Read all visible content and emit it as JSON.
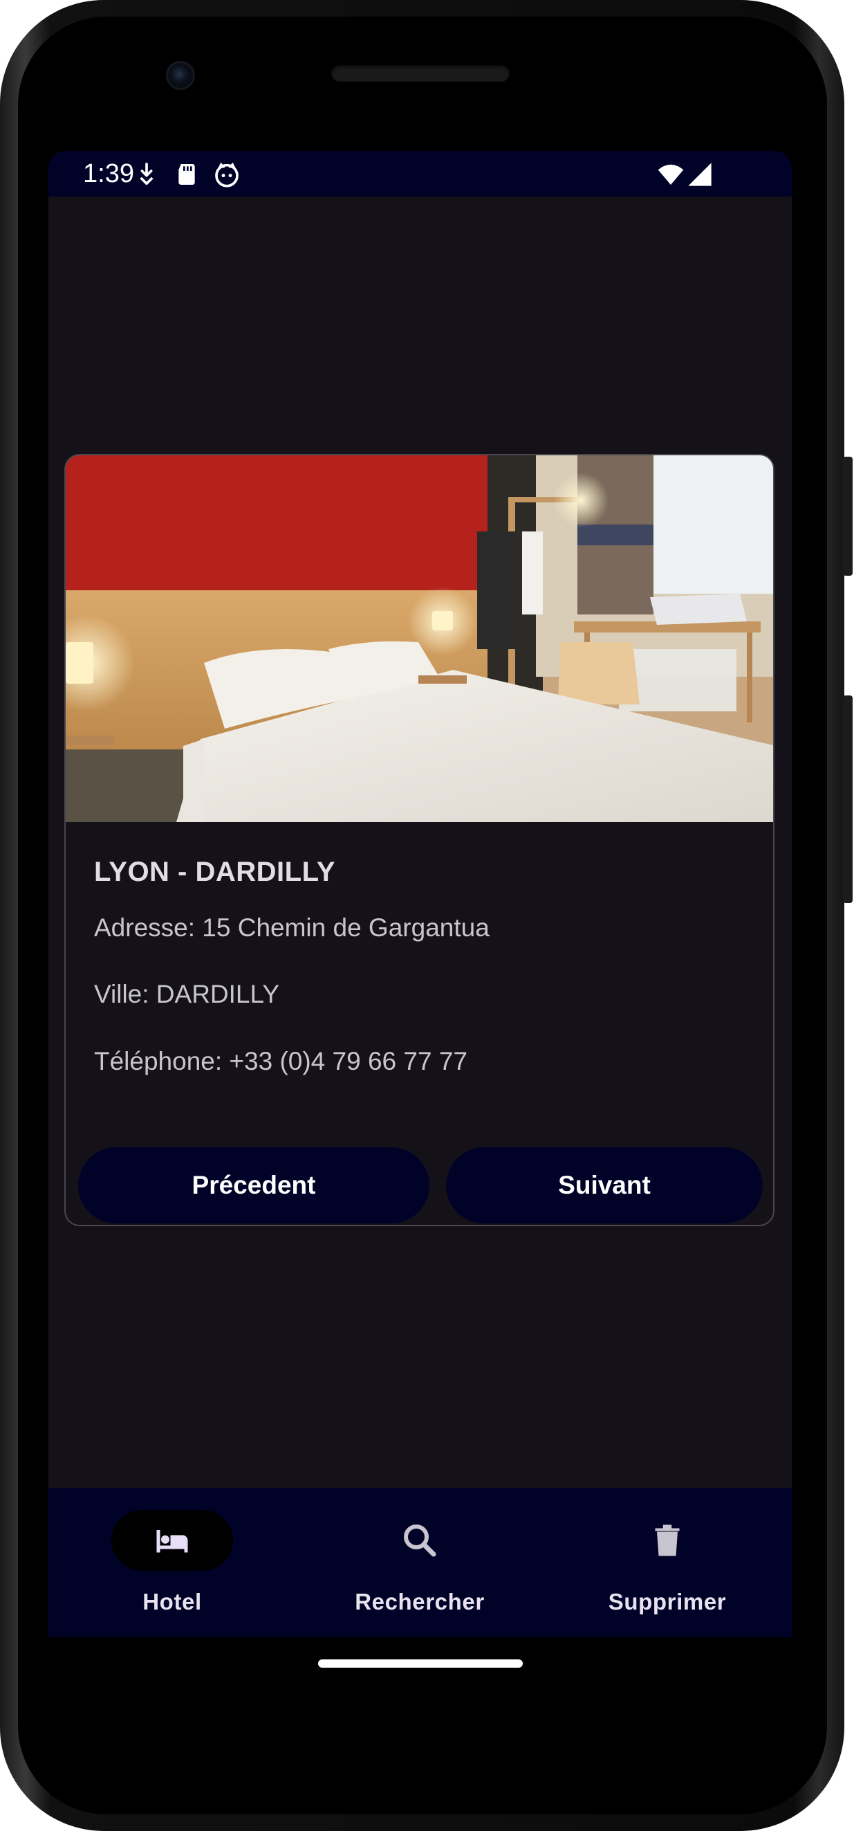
{
  "status_bar": {
    "time": "1:39",
    "icons": [
      "download-icon",
      "sd-card-icon",
      "cat-face-icon",
      "wifi-icon",
      "cell-signal-icon"
    ]
  },
  "hotel": {
    "name": "LYON - DARDILLY",
    "address_line": "Adresse: 15 Chemin de Gargantua",
    "city_line": "Ville: DARDILLY",
    "phone_line": "Téléphone: +33 (0)4 79 66 77 77",
    "image_icon": "hotel-room-photo"
  },
  "buttons": {
    "previous": "Précedent",
    "next": "Suivant"
  },
  "bottom_nav": {
    "items": [
      {
        "label": "Hotel",
        "icon": "bed-icon",
        "selected": true
      },
      {
        "label": "Rechercher",
        "icon": "search-icon",
        "selected": false
      },
      {
        "label": "Supprimer",
        "icon": "trash-icon",
        "selected": false
      }
    ]
  },
  "colors": {
    "screen_bg": "#141218",
    "bar_bg": "#010228",
    "button_bg": "#010228",
    "text_primary": "#e0dde6"
  }
}
